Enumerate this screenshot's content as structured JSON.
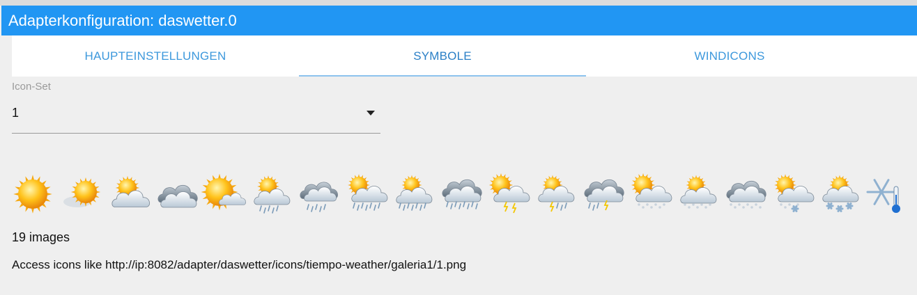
{
  "window": {
    "title": "Adapterkonfiguration: daswetter.0"
  },
  "tabs": [
    {
      "label": "HAUPTEINSTELLUNGEN",
      "active": false
    },
    {
      "label": "SYMBOLE",
      "active": true
    },
    {
      "label": "WINDICONS",
      "active": false
    }
  ],
  "iconset": {
    "label": "Icon-Set",
    "value": "1"
  },
  "icons": [
    {
      "name": "sun-icon"
    },
    {
      "name": "sun-haze-icon"
    },
    {
      "name": "sun-cloud-icon"
    },
    {
      "name": "clouds-icon"
    },
    {
      "name": "sun-partly-cloudy-icon"
    },
    {
      "name": "sun-cloud-rain-icon"
    },
    {
      "name": "cloud-rain-icon"
    },
    {
      "name": "sun-cloud-heavy-rain-icon"
    },
    {
      "name": "sun-cloud-showers-icon"
    },
    {
      "name": "cloud-heavy-rain-icon"
    },
    {
      "name": "sun-cloud-thunder-icon"
    },
    {
      "name": "sun-cloud-thunder-rain-icon"
    },
    {
      "name": "cloud-thunder-icon"
    },
    {
      "name": "sun-cloud-snow-icon"
    },
    {
      "name": "sun-cloud-light-snow-icon"
    },
    {
      "name": "cloud-snow-icon"
    },
    {
      "name": "sun-cloud-snowflakes-icon"
    },
    {
      "name": "sun-cloud-heavy-snow-icon"
    },
    {
      "name": "snowflake-thermometer-icon"
    }
  ],
  "info": {
    "count": "19 images",
    "access": "Access icons like http://ip:8082/adapter/daswetter/icons/tiempo-weather/galeria1/1.png"
  },
  "colors": {
    "header": "#2196f3",
    "tab_text": "#3c98dc",
    "sun": "#f5a40e",
    "cloud": "#8a98a6"
  }
}
